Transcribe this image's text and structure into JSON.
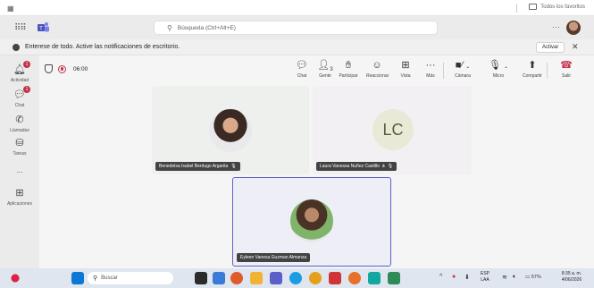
{
  "browser": {
    "favorites_label": "Todos los favoritos"
  },
  "title_bar": {
    "search_placeholder": "Búsqueda (Ctrl+Alt+E)",
    "more_label": "···"
  },
  "notification": {
    "message": "Enterese de todo. Active las notificaciones de escritorio.",
    "activate_label": "Activar",
    "close_label": "✕"
  },
  "rail": {
    "items": [
      {
        "label": "Actividad",
        "icon": "bell-icon",
        "badge": "1"
      },
      {
        "label": "Chat",
        "icon": "chat-icon",
        "badge": "1"
      },
      {
        "label": "Llamadas",
        "icon": "phone-icon",
        "badge": ""
      },
      {
        "label": "Tareas",
        "icon": "tasks-icon",
        "badge": ""
      },
      {
        "label": "...",
        "icon": "more-icon",
        "badge": ""
      },
      {
        "label": "Aplicaciones",
        "icon": "apps-icon",
        "badge": ""
      }
    ]
  },
  "toolbar": {
    "timer": "06:00",
    "buttons": [
      {
        "label": "Chat",
        "icon": "chat-icon"
      },
      {
        "label": "Gente",
        "icon": "people-icon",
        "count": "3"
      },
      {
        "label": "Participar",
        "icon": "raise-hand-icon"
      },
      {
        "label": "Reaccionar",
        "icon": "smiley-icon"
      },
      {
        "label": "Vista",
        "icon": "grid-view-icon"
      },
      {
        "label": "Más",
        "icon": "more-icon"
      },
      {
        "label": "Cámara",
        "icon": "camera-off-icon"
      },
      {
        "label": "Micro",
        "icon": "mic-off-icon"
      },
      {
        "label": "Compartir",
        "icon": "share-icon"
      },
      {
        "label": "Salir",
        "icon": "hang-up-icon"
      }
    ]
  },
  "participants": [
    {
      "name": "Benedelsa Isabel Berdugo Argarita",
      "initials": "",
      "has_photo": true
    },
    {
      "name": "Laura Vanessa Nuñez Castillo",
      "initials": "LC",
      "has_photo": false
    },
    {
      "name": "Eyleen Vanesa Guzman Almanza",
      "initials": "",
      "has_photo": true,
      "active_speaker": true
    }
  ],
  "taskbar": {
    "search_placeholder": "Buscar",
    "lang_line1": "ESP",
    "lang_line2": "LAA",
    "battery": "57%",
    "time": "8:35 a. m.",
    "date": "4/06/2026"
  },
  "colors": {
    "accent": "#5b5fc7",
    "alert": "#c4314b",
    "lc_avatar_bg": "#e8ead7"
  }
}
